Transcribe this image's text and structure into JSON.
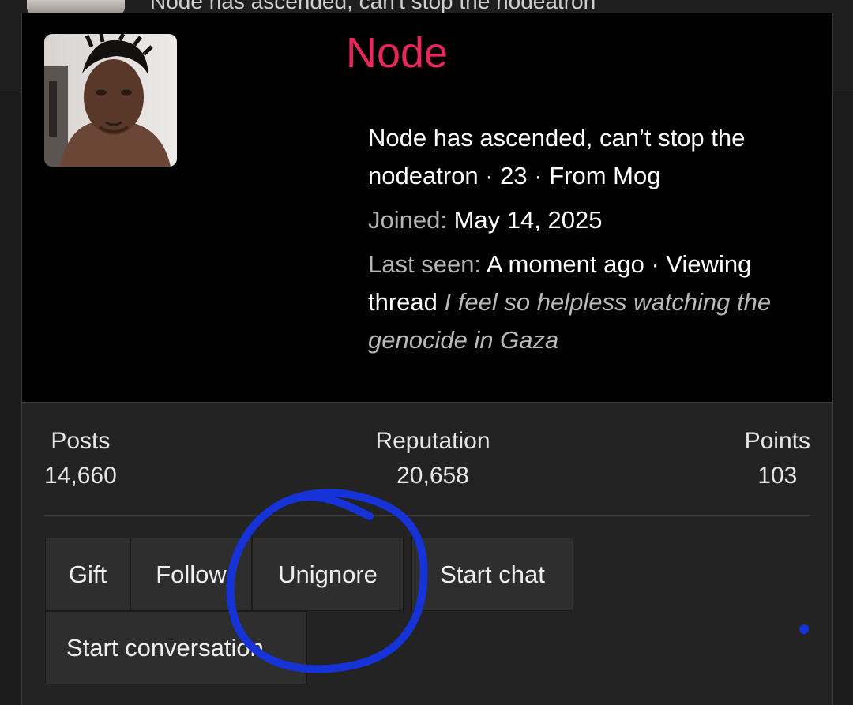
{
  "background": {
    "partial_text": "Node has ascended, can't stop the nodeatron"
  },
  "profile": {
    "username": "Node",
    "tagline": "Node has ascended, can’t stop the nodeatron · 23 · From Mog",
    "joined_label": "Joined:",
    "joined_value": "May 14, 2025",
    "last_seen_label": "Last seen:",
    "last_seen_value": "A moment ago · Viewing thread",
    "last_seen_thread": "I feel so helpless watching the genocide in Gaza"
  },
  "stats": {
    "posts_label": "Posts",
    "posts_value": "14,660",
    "reputation_label": "Reputation",
    "reputation_value": "20,658",
    "points_label": "Points",
    "points_value": "103"
  },
  "actions": {
    "gift": "Gift",
    "follow": "Follow",
    "unignore": "Unignore",
    "start_chat": "Start chat",
    "start_conversation": "Start conversation"
  },
  "colors": {
    "username": "#e8285a",
    "annotation": "#1533d6",
    "card_top": "#000000",
    "card_body": "#232323",
    "button": "#2e2e2e"
  }
}
